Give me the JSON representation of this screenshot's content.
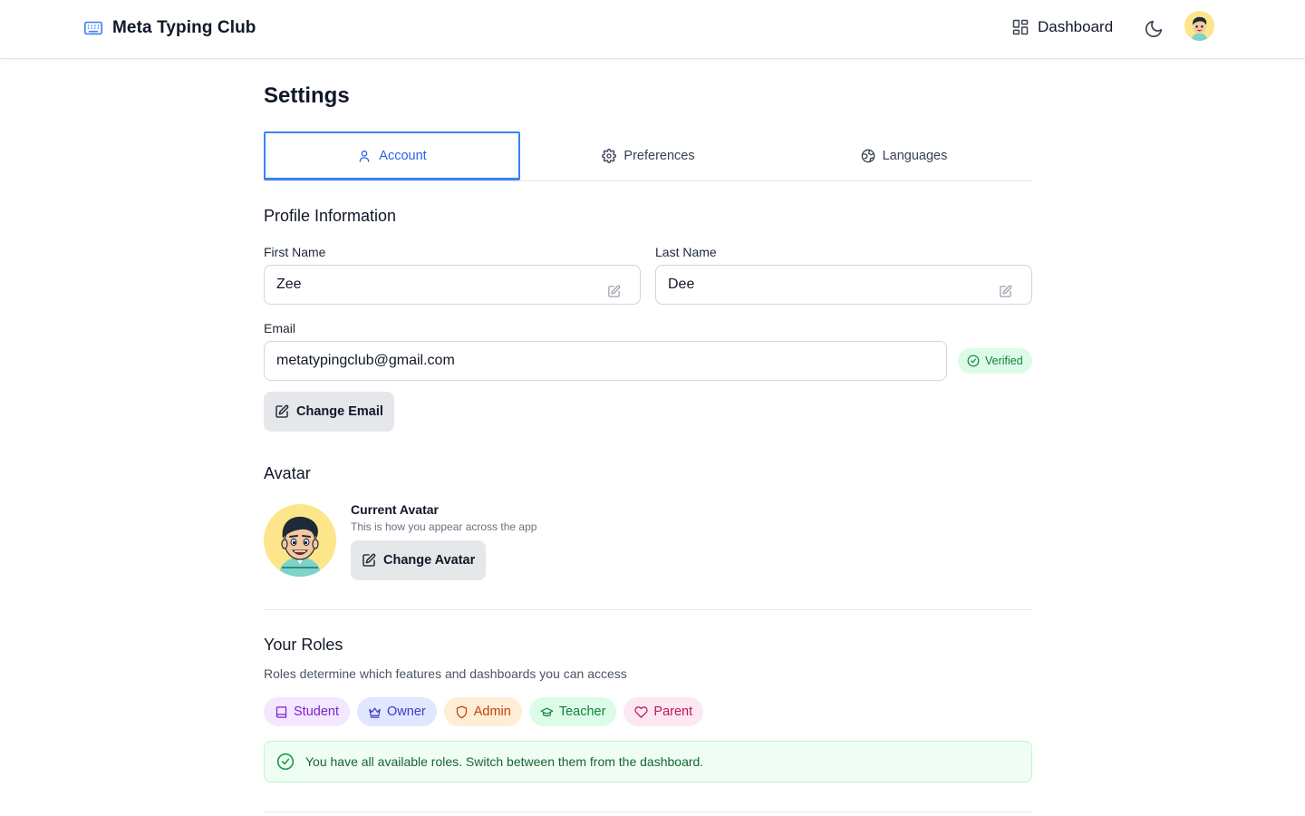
{
  "header": {
    "brand": "Meta Typing Club",
    "brand_icon": "keyboard-icon",
    "nav_dashboard": "Dashboard",
    "theme_icon": "moon-icon"
  },
  "page": {
    "title": "Settings"
  },
  "tabs": [
    {
      "label": "Account",
      "icon": "user-icon",
      "active": true
    },
    {
      "label": "Preferences",
      "icon": "gear-icon",
      "active": false
    },
    {
      "label": "Languages",
      "icon": "globe-icon",
      "active": false
    }
  ],
  "profile": {
    "section_title": "Profile Information",
    "first_name_label": "First Name",
    "first_name_value": "Zee",
    "last_name_label": "Last Name",
    "last_name_value": "Dee",
    "email_label": "Email",
    "email_value": "metatypingclub@gmail.com",
    "verified_label": "Verified",
    "change_email_label": "Change Email"
  },
  "avatar": {
    "section_title": "Avatar",
    "heading": "Current Avatar",
    "subtitle": "This is how you appear across the app",
    "change_label": "Change Avatar"
  },
  "roles": {
    "section_title": "Your Roles",
    "description": "Roles determine which features and dashboards you can access",
    "items": [
      {
        "label": "Student",
        "icon": "book-icon"
      },
      {
        "label": "Owner",
        "icon": "crown-icon"
      },
      {
        "label": "Admin",
        "icon": "shield-icon"
      },
      {
        "label": "Teacher",
        "icon": "graduation-cap-icon"
      },
      {
        "label": "Parent",
        "icon": "heart-icon"
      }
    ],
    "notice": "You have all available roles. Switch between them from the dashboard."
  },
  "colors": {
    "accent": "#3b82f6",
    "verified_bg": "#dcfce7",
    "verified_text": "#15803d",
    "notice_bg": "#f0fdf4"
  }
}
